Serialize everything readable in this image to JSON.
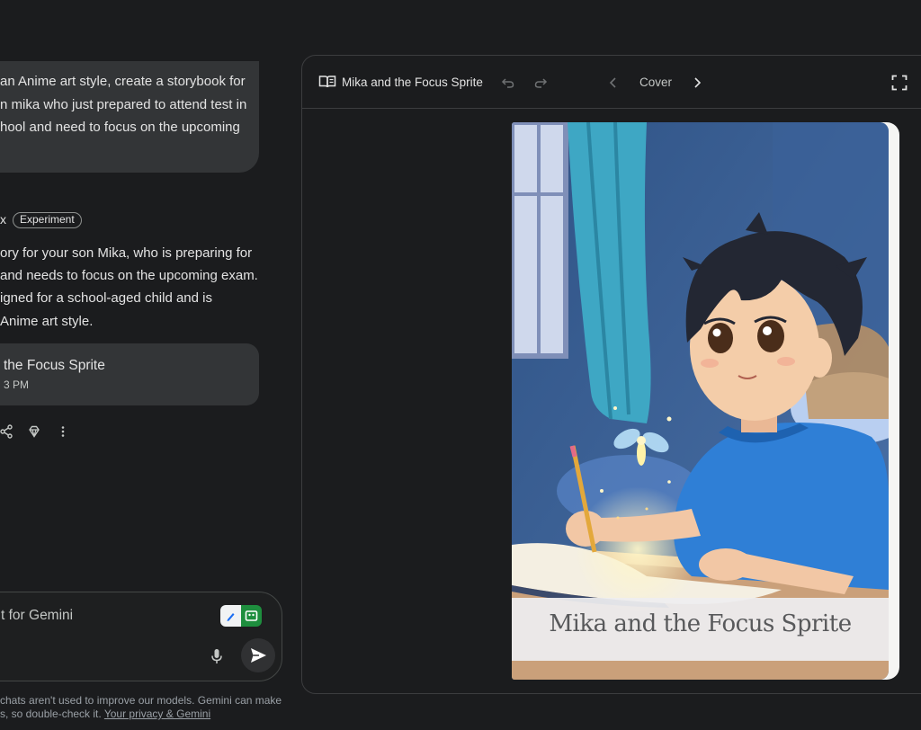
{
  "chat": {
    "user_message_lines": [
      "an Anime art style, create a storybook for",
      "n mika who just prepared to attend test in",
      "hool and need to focus on the upcoming"
    ],
    "model_name_fragment": "x",
    "experiment_badge": "Experiment",
    "response_lines": [
      "ory for your son Mika, who is preparing for",
      "and needs to focus on the upcoming exam.",
      "igned for a school-aged child and is",
      "Anime art style."
    ],
    "story_card": {
      "title": " the Focus Sprite",
      "time": "3 PM"
    },
    "actions": [
      "share-icon",
      "gem-icon",
      "more-vert-icon"
    ]
  },
  "input": {
    "placeholder": "t for Gemini",
    "mic_icon": "mic-icon",
    "send_icon": "send-icon"
  },
  "disclaimer": {
    "line1": "chats aren't used to improve our models. Gemini can make",
    "line2": "s, so double-check it. ",
    "link": "Your privacy & Gemini"
  },
  "canvas": {
    "title": "Mika and the Focus Sprite",
    "page_label": "Cover",
    "icons": [
      "book-icon",
      "undo-icon",
      "redo-icon",
      "prev-page-icon",
      "next-page-icon",
      "fullscreen-icon"
    ]
  },
  "book": {
    "cover_title": "Mika and the Focus Sprite"
  },
  "colors": {
    "background": "#1b1c1e",
    "bubble": "#333537",
    "text": "#e3e3e3",
    "cover_wall": "#3d6090",
    "shirt": "#2f7fd6"
  }
}
